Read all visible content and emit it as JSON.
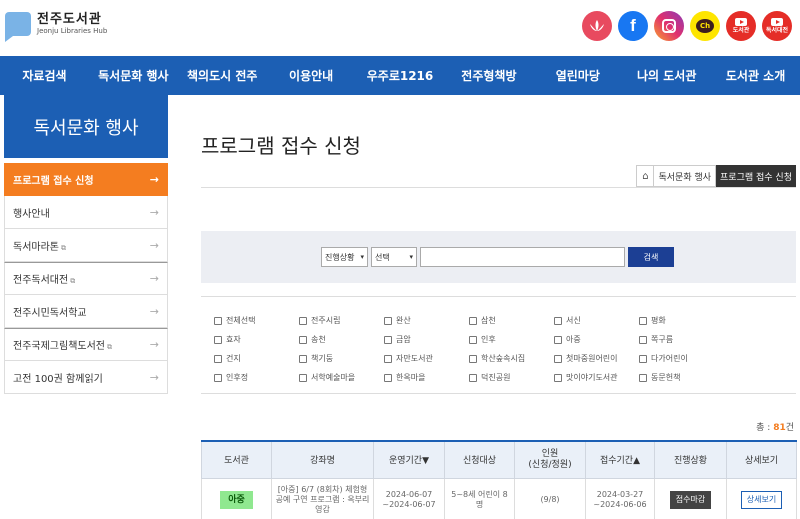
{
  "header": {
    "logo_title": "전주도서관",
    "logo_subtitle": "Jeonju Libraries Hub",
    "social": [
      {
        "name": "lotus-icon",
        "label": ""
      },
      {
        "name": "facebook-icon",
        "label": "f"
      },
      {
        "name": "instagram-icon",
        "label": ""
      },
      {
        "name": "kakao-channel-icon",
        "label": "Ch"
      },
      {
        "name": "youtube-library-icon",
        "label": "도서관"
      },
      {
        "name": "youtube-festival-icon",
        "label": "독서대전"
      }
    ]
  },
  "nav": {
    "items": [
      "자료검색",
      "독서문화 행사",
      "책의도시 전주",
      "이용안내",
      "우주로1216",
      "전주형책방",
      "열린마당",
      "나의 도서관",
      "도서관 소개"
    ]
  },
  "sidebar": {
    "title": "독서문화 행사",
    "items": [
      {
        "label": "프로그램 접수 신청",
        "ext": "",
        "arrow": "→"
      },
      {
        "label": "행사안내",
        "ext": "",
        "arrow": "→"
      },
      {
        "label": "독서마라톤",
        "ext": "⧉",
        "arrow": "→"
      },
      {
        "label": "전주독서대전",
        "ext": "⧉",
        "arrow": "→"
      },
      {
        "label": "전주시민독서학교",
        "ext": "",
        "arrow": "→"
      },
      {
        "label": "전주국제그림책도서전",
        "ext": "⧉",
        "arrow": "→"
      },
      {
        "label": "고전 100권 함께읽기",
        "ext": "",
        "arrow": "→"
      }
    ]
  },
  "main": {
    "title": "프로그램 접수 신청",
    "breadcrumb": {
      "home_icon": "⌂",
      "parent": "독서문화 행사",
      "current": "프로그램 접수 신청"
    }
  },
  "search": {
    "status_select": "진행상황",
    "type_select": "선택",
    "caret": "▾",
    "input_value": "",
    "button_label": "검색"
  },
  "filters": [
    "전체선택",
    "전주시립",
    "완산",
    "삼천",
    "서신",
    "평화",
    "효자",
    "송천",
    "금암",
    "인후",
    "아중",
    "쪽구름",
    "건지",
    "책기둥",
    "자만도서관",
    "학산숲속시집",
    "첫마중원어린이",
    "다가어린이",
    "인후정",
    "서학예술마을",
    "한옥마을",
    "덕진공원",
    "맛이야기도서관",
    "동문헌책"
  ],
  "total": {
    "prefix": "총 : ",
    "count": "81",
    "suffix": "건"
  },
  "table": {
    "headers": [
      "도서관",
      "강좌명",
      "운영기간▼",
      "신청대상",
      "인원\n(신청/정원)",
      "접수기간▲",
      "진행상황",
      "상세보기"
    ],
    "rows": [
      {
        "library": "아중",
        "title": "[아중] 6/7 (8회차) 체험형 공예 구연 프로그램 : 옥부리 영감",
        "period": "2024-06-07 ~2024-06-07",
        "target": "5~8세 어린이 8명",
        "people": "(9/8)",
        "apply_period": "2024-03-27 ~2024-06-06",
        "status": "접수마감",
        "detail": "상세보기"
      }
    ]
  }
}
